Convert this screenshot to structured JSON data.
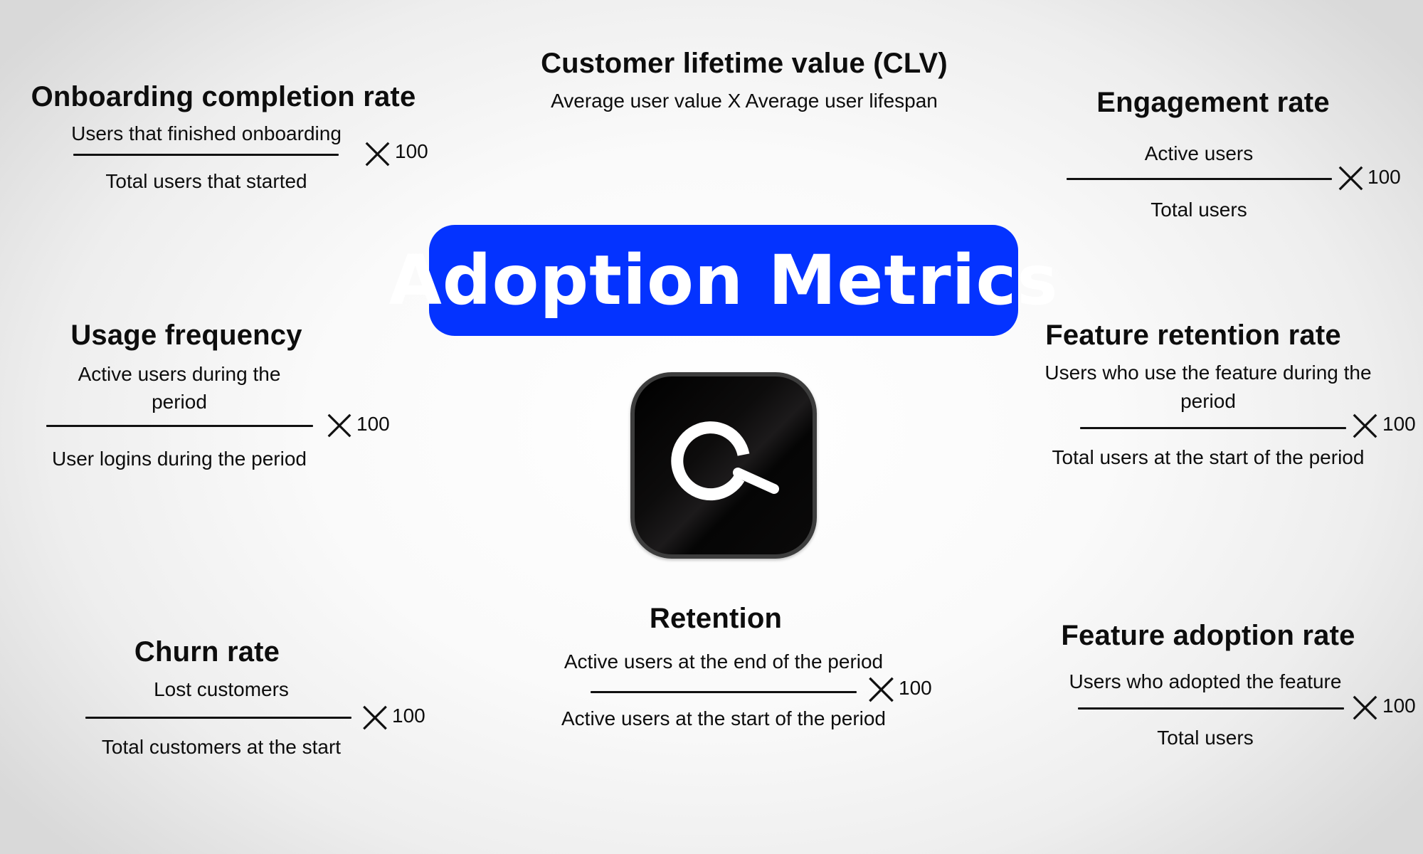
{
  "banner": {
    "title": "Adoption Metrics",
    "color": "#0433ff"
  },
  "logo": {
    "icon": "search-magnifier-icon"
  },
  "multiplier_label": "100",
  "multiplier_icon": "times-icon",
  "clv": {
    "title": "Customer lifetime value (CLV)",
    "formula": "Average user value X Average user lifespan"
  },
  "onboarding": {
    "title": "Onboarding completion rate",
    "numerator": "Users that finished onboarding",
    "denominator": "Total users that started",
    "multiplier": "100"
  },
  "engagement": {
    "title": "Engagement rate",
    "numerator": "Active users",
    "denominator": "Total users",
    "multiplier": "100"
  },
  "usage": {
    "title": "Usage frequency",
    "numerator_line1": "Active users during the",
    "numerator_line2": "period",
    "denominator": "User logins during the period",
    "multiplier": "100"
  },
  "feature_retention": {
    "title": "Feature retention rate",
    "numerator_line1": "Users who use the feature during the",
    "numerator_line2": "period",
    "denominator": "Total users at the start of the period",
    "multiplier": "100"
  },
  "retention": {
    "title": "Retention",
    "numerator": "Active users at the end of the period",
    "denominator": "Active users at the start of the period",
    "multiplier": "100"
  },
  "churn": {
    "title": "Churn rate",
    "numerator": "Lost customers",
    "denominator": "Total customers at the start",
    "multiplier": "100"
  },
  "feature_adoption": {
    "title": "Feature adoption rate",
    "numerator": "Users who adopted the feature",
    "denominator": "Total users",
    "multiplier": "100"
  }
}
